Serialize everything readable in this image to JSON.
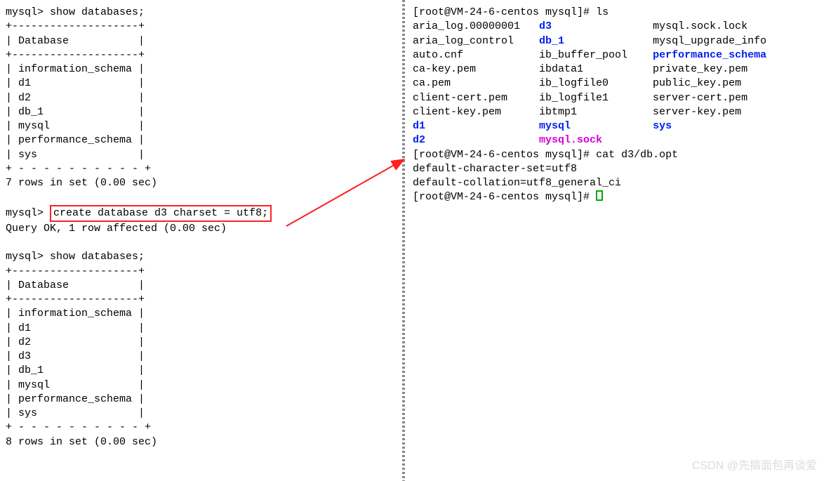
{
  "left": {
    "prompt": "mysql>",
    "cmd1": "show databases;",
    "header": "Database",
    "hr": "+--------------------+",
    "dash": "+ - - - - - - - - - - +",
    "rows1": [
      "information_schema",
      "d1",
      "d2",
      "db_1",
      "mysql",
      "performance_schema",
      "sys"
    ],
    "footer1": "7 rows in set (0.00 sec)",
    "cmd2": "create database d3 charset = utf8;",
    "res2": "Query OK, 1 row affected (0.00 sec)",
    "cmd3": "show databases;",
    "rows2": [
      "information_schema",
      "d1",
      "d2",
      "d3",
      "db_1",
      "mysql",
      "performance_schema",
      "sys"
    ],
    "footer2": "8 rows in set (0.00 sec)"
  },
  "right": {
    "prompt": "[root@VM-24-6-centos mysql]#",
    "cmd1": "ls",
    "ls": {
      "col1": [
        {
          "t": "aria_log.00000001"
        },
        {
          "t": "aria_log_control"
        },
        {
          "t": "auto.cnf"
        },
        {
          "t": "ca-key.pem"
        },
        {
          "t": "ca.pem"
        },
        {
          "t": "client-cert.pem"
        },
        {
          "t": "client-key.pem"
        },
        {
          "t": "d1",
          "c": "blue"
        },
        {
          "t": "d2",
          "c": "blue"
        }
      ],
      "col2": [
        {
          "t": "d3",
          "c": "blue"
        },
        {
          "t": "db_1",
          "c": "blue"
        },
        {
          "t": "ib_buffer_pool"
        },
        {
          "t": "ibdata1"
        },
        {
          "t": "ib_logfile0"
        },
        {
          "t": "ib_logfile1"
        },
        {
          "t": "ibtmp1"
        },
        {
          "t": "mysql",
          "c": "blue"
        },
        {
          "t": "mysql.sock",
          "c": "magenta"
        }
      ],
      "col3": [
        {
          "t": "mysql.sock.lock"
        },
        {
          "t": "mysql_upgrade_info"
        },
        {
          "t": "performance_schema",
          "c": "blue"
        },
        {
          "t": "private_key.pem"
        },
        {
          "t": "public_key.pem"
        },
        {
          "t": "server-cert.pem"
        },
        {
          "t": "server-key.pem"
        },
        {
          "t": "sys",
          "c": "blue"
        },
        {
          "t": ""
        }
      ]
    },
    "cmd2": "cat d3/db.opt",
    "out": [
      "default-character-set=utf8",
      "default-collation=utf8_general_ci"
    ]
  },
  "watermark": "CSDN @先搞面包再谈爱"
}
